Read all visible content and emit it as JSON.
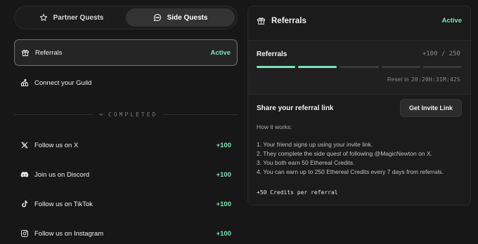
{
  "tabs": [
    {
      "label": "Partner Quests",
      "icon": "star-icon",
      "active": false
    },
    {
      "label": "Side Quests",
      "icon": "chat-bubble-icon",
      "active": true
    }
  ],
  "quests": {
    "referrals": {
      "label": "Referrals",
      "status": "Active",
      "icon": "gift-icon"
    },
    "guild": {
      "label": "Connect your Guild",
      "icon": "castle-icon"
    }
  },
  "completed": {
    "label": "COMPLETED",
    "items": [
      {
        "label": "Follow us on X",
        "reward": "+100",
        "icon": "x-logo-icon"
      },
      {
        "label": "Join us on Discord",
        "reward": "+100",
        "icon": "discord-icon"
      },
      {
        "label": "Follow us on TikTok",
        "reward": "+100",
        "icon": "tiktok-icon"
      },
      {
        "label": "Follow us on Instagram",
        "reward": "+100",
        "icon": "instagram-icon"
      }
    ]
  },
  "panel": {
    "title": "Referrals",
    "status": "Active",
    "progress": {
      "label": "Referrals",
      "count_text": "+100 / 250",
      "current": 100,
      "max": 250,
      "segments_total": 5,
      "segments_filled": 2,
      "reset_label": "Reset in",
      "reset_time": "20:20H:31M:42S"
    },
    "share_title": "Share your referral link",
    "invite_button": "Get Invite Link",
    "how_title": "How it works:",
    "steps": [
      "1. Your friend signs up using your invite link.",
      "2. They complete the side quest of following @MagicNewton on X.",
      "3. You both earn 50 Ethereal Credits.",
      "4. You can earn up to 250 Ethereal Credits every 7 days from referrals."
    ],
    "credits_note": "+50 Credits per referral"
  },
  "colors": {
    "accent": "#7ee3b8",
    "background": "#171717",
    "panel": "#1b1b1b",
    "selected_border": "#6a6a6a"
  }
}
